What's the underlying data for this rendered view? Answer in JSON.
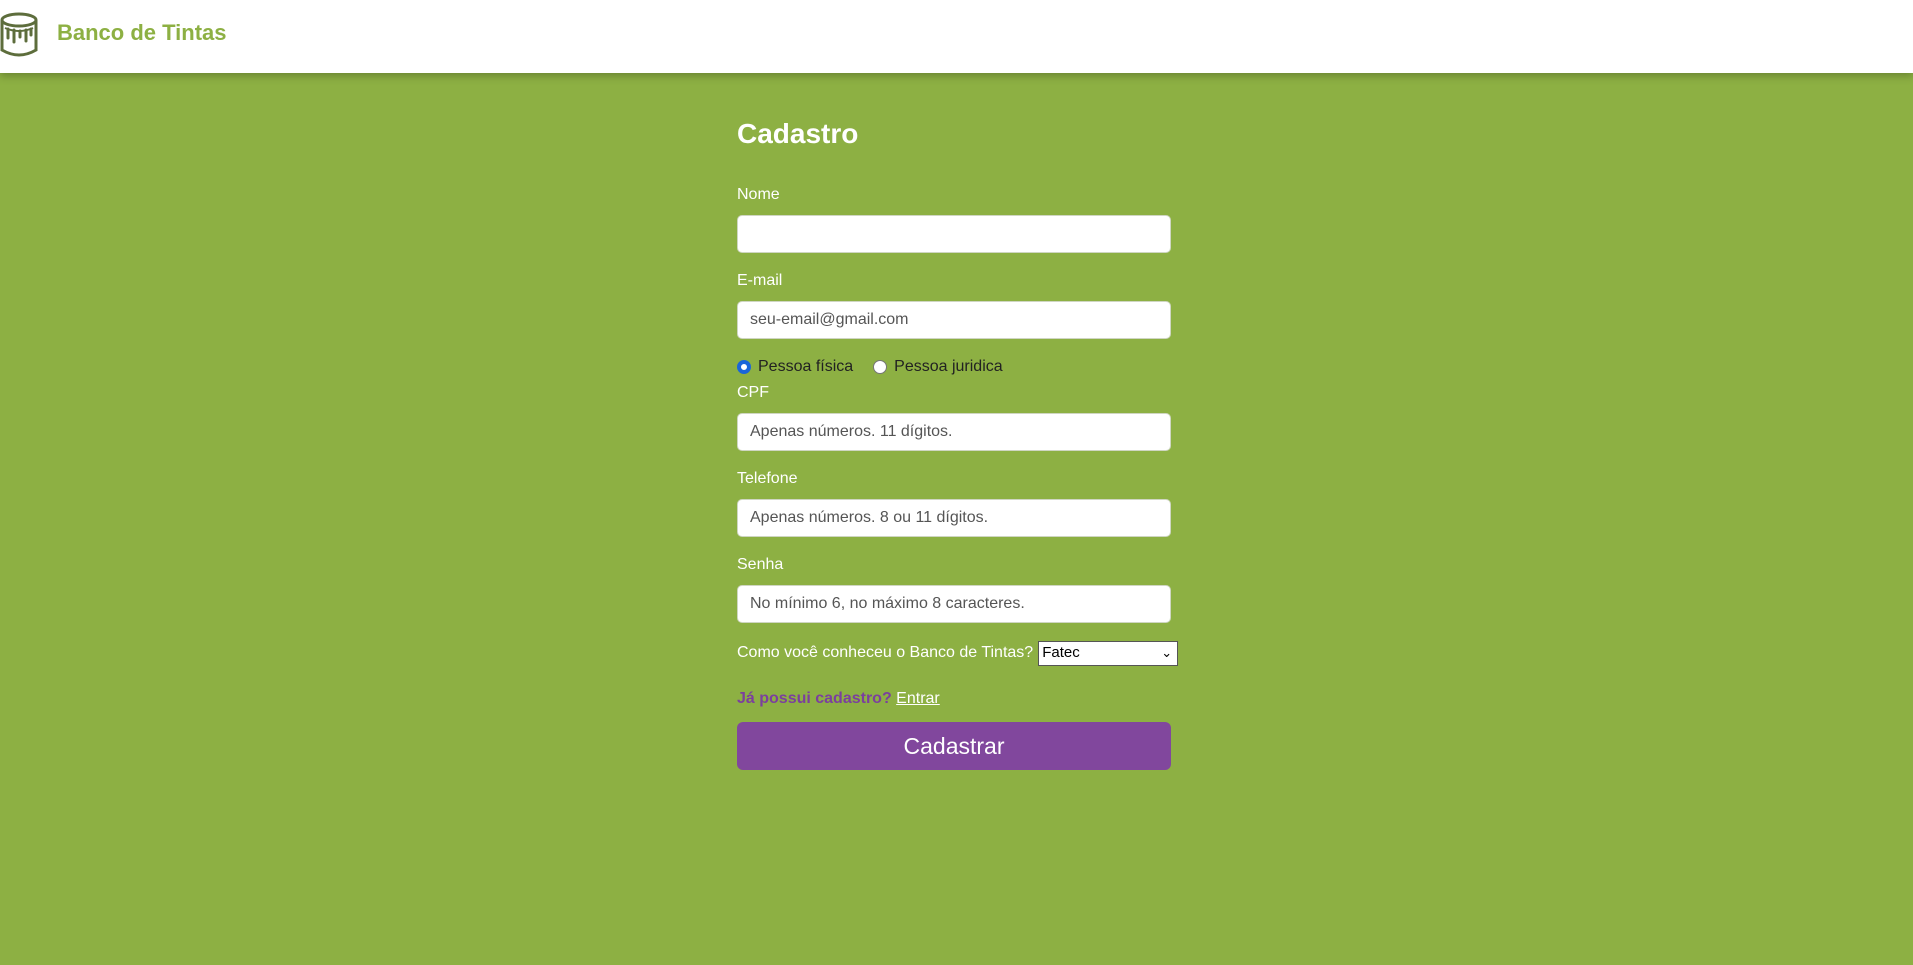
{
  "header": {
    "logo_icon": "paint-bucket-icon",
    "brand": "Banco de Tintas"
  },
  "form": {
    "title": "Cadastro",
    "nome": {
      "label": "Nome",
      "value": "",
      "placeholder": ""
    },
    "email": {
      "label": "E-mail",
      "value": "",
      "placeholder": "seu-email@gmail.com"
    },
    "tipo_pessoa": {
      "options": [
        {
          "label": "Pessoa física",
          "checked": true
        },
        {
          "label": "Pessoa juridica",
          "checked": false
        }
      ]
    },
    "cpf": {
      "label": "CPF",
      "value": "",
      "placeholder": "Apenas números. 11 dígitos."
    },
    "telefone": {
      "label": "Telefone",
      "value": "",
      "placeholder": "Apenas números. 8 ou 11 dígitos."
    },
    "senha": {
      "label": "Senha",
      "value": "",
      "placeholder": "No mínimo 6, no máximo 8 caracteres."
    },
    "origem": {
      "label": "Como você conheceu o Banco de Tintas?",
      "selected": "Fatec"
    },
    "login": {
      "question": "Já possui cadastro?",
      "link": "Entrar"
    },
    "submit_label": "Cadastrar"
  },
  "colors": {
    "background": "#8db043",
    "brand": "#8db043",
    "button": "#81479d",
    "link_question": "#7b3f9e"
  }
}
